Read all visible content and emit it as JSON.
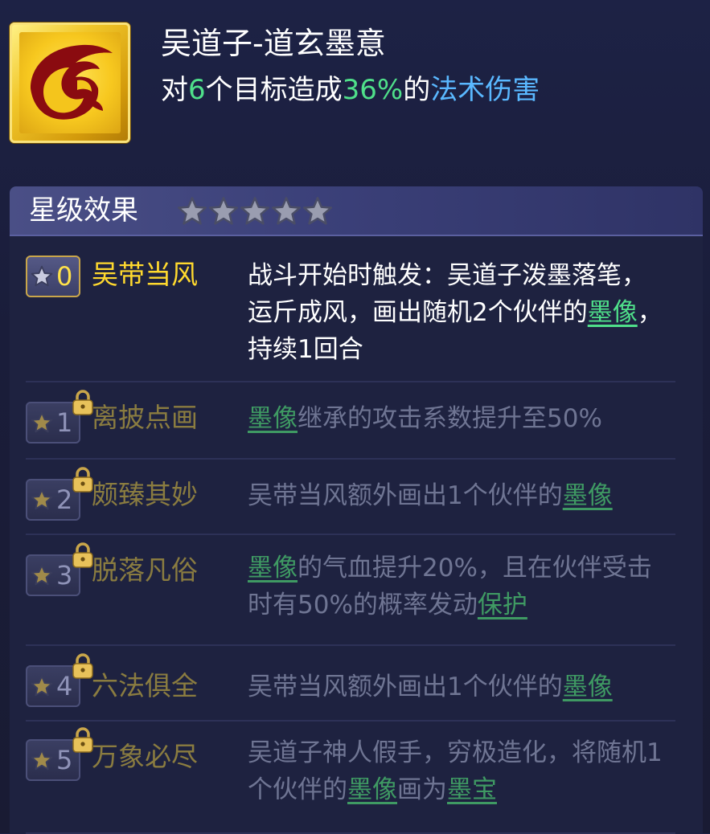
{
  "skill": {
    "icon": "ink-brush-icon",
    "title": "吴道子-道玄墨意",
    "desc_prefix": "对",
    "targets": "6",
    "desc_mid": "个目标造成",
    "percent": "36%",
    "desc_mid2": "的",
    "damage_type": "法术伤害",
    "colors": {
      "green": "#4fe08a",
      "blue": "#5ab8ff",
      "gold": "#ffd92e"
    }
  },
  "star_panel": {
    "title": "星级效果",
    "stars_total": 5,
    "stars_filled": 0
  },
  "effects": [
    {
      "star": "0",
      "locked": false,
      "name": "吴带当风",
      "parts": [
        {
          "t": "战斗开始时触发：吴道子泼墨落笔，运斤成风，画出随机2个伙伴的"
        },
        {
          "t": "墨像",
          "link": true
        },
        {
          "t": "，持续1回合"
        }
      ]
    },
    {
      "star": "1",
      "locked": true,
      "name": "离披点画",
      "parts": [
        {
          "t": "墨像",
          "link": true
        },
        {
          "t": "继承的攻击系数提升至50%"
        }
      ]
    },
    {
      "star": "2",
      "locked": true,
      "name": "颇臻其妙",
      "parts": [
        {
          "t": "吴带当风额外画出1个伙伴的"
        },
        {
          "t": "墨像",
          "link": true
        }
      ]
    },
    {
      "star": "3",
      "locked": true,
      "name": "脱落凡俗",
      "parts": [
        {
          "t": "墨像",
          "link": true
        },
        {
          "t": "的气血提升20%，且在伙伴受击时有50%的概率发动"
        },
        {
          "t": "保护",
          "link": true
        }
      ]
    },
    {
      "star": "4",
      "locked": true,
      "name": "六法俱全",
      "parts": [
        {
          "t": "吴带当风额外画出1个伙伴的"
        },
        {
          "t": "墨像",
          "link": true
        }
      ]
    },
    {
      "star": "5",
      "locked": true,
      "name": "万象必尽",
      "parts": [
        {
          "t": "吴道子神人假手，穷极造化，将随机1个伙伴的"
        },
        {
          "t": "墨像",
          "link": true
        },
        {
          "t": "画为"
        },
        {
          "t": "墨宝",
          "link": true
        }
      ]
    }
  ]
}
